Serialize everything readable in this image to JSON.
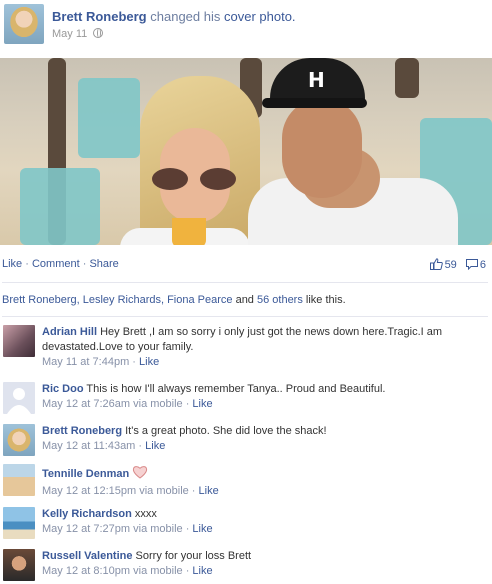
{
  "post": {
    "author": "Brett Roneberg",
    "action_text": "changed his",
    "object_link": "cover photo.",
    "date": "May 11",
    "privacy_icon": "globe-icon"
  },
  "actions": {
    "like": "Like",
    "sep1": " · ",
    "comment": "Comment",
    "sep2": " · ",
    "share": "Share"
  },
  "counts": {
    "likes": "59",
    "comments": "6"
  },
  "likes_line": {
    "names": "Brett Roneberg, Lesley Richards, Fiona Pearce",
    "and_text": " and ",
    "others": "56 others",
    "tail": " like this."
  },
  "comments": [
    {
      "name": "Adrian Hill",
      "text": " Hey Brett ,I am so sorry i only just got the news down here.Tragic.I am devastated.Love to your family.",
      "time": "May 11 at 7:44pm",
      "via": "",
      "like": "Like",
      "avatar_color": "#7a5a6a"
    },
    {
      "name": "Ric Doo",
      "text": " This is how I'll always remember Tanya.. Proud and Beautiful.",
      "time": "May 12 at 7:26am",
      "via": " via mobile",
      "like": "Like",
      "avatar_color": "#d8dce6"
    },
    {
      "name": "Brett Roneberg",
      "text": " It's a great photo. She did love the shack!",
      "time": "May 12 at 11:43am",
      "via": "",
      "like": "Like",
      "avatar_color": "#c9a866"
    },
    {
      "name": "Tennille Denman",
      "text": "",
      "time": "May 12 at 12:15pm",
      "via": " via mobile",
      "like": "Like",
      "avatar_color": "#d9a07a"
    },
    {
      "name": "Kelly Richardson",
      "text": " xxxx",
      "time": "May 12 at 7:27pm",
      "via": " via mobile",
      "like": "Like",
      "avatar_color": "#7fb4d8"
    },
    {
      "name": "Russell Valentine",
      "text": " Sorry for your loss Brett",
      "time": "May 12 at 8:10pm",
      "via": " via mobile",
      "like": "Like",
      "avatar_color": "#a0704e"
    }
  ],
  "colors": {
    "link": "#3b5998",
    "meta": "#8791a8",
    "heart": "#e8a0a0"
  }
}
